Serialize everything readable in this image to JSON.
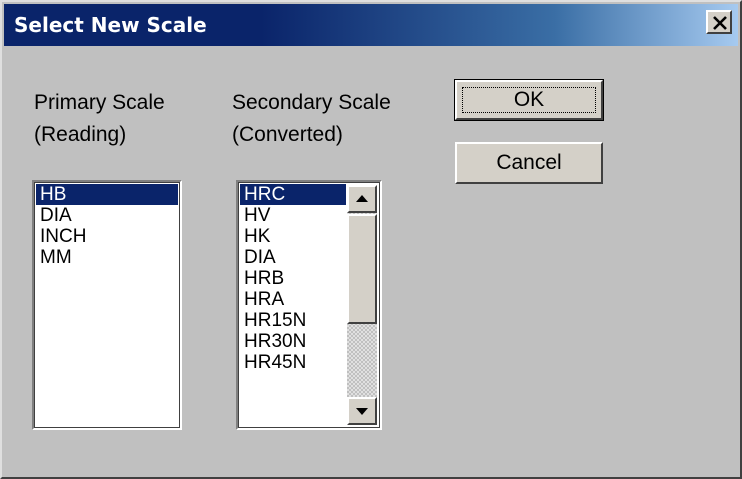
{
  "window": {
    "title": "Select New Scale"
  },
  "icons": {
    "close": "close-icon",
    "scroll_up": "up-arrow-icon",
    "scroll_down": "down-arrow-icon"
  },
  "colors": {
    "titlebar_start": "#0a246a",
    "titlebar_end": "#a6caf0",
    "selection": "#0a246a",
    "dialog_bg": "#c0c0c0"
  },
  "primary": {
    "label_line1": "Primary Scale",
    "label_line2": "(Reading)",
    "items": [
      "HB",
      "DIA",
      "INCH",
      "MM"
    ],
    "selected": "HB"
  },
  "secondary": {
    "label_line1": "Secondary Scale",
    "label_line2": "(Converted)",
    "items": [
      "HRC",
      "HV",
      "HK",
      "DIA",
      "HRB",
      "HRA",
      "HR15N",
      "HR30N",
      "HR45N"
    ],
    "selected": "HRC"
  },
  "buttons": {
    "ok": "OK",
    "cancel": "Cancel"
  }
}
